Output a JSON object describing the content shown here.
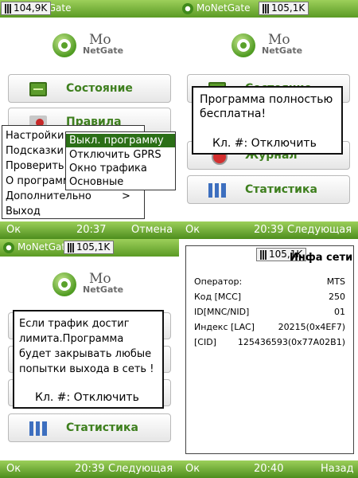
{
  "screen1": {
    "title": "MoNetGate",
    "net_speed": "104,9K",
    "logo": {
      "line1": "Mo",
      "line2": "NetGate"
    },
    "buttons": {
      "status": "Состояние",
      "rules": "Правила"
    },
    "menu": {
      "items": [
        "Настройки",
        "Подсказки",
        "Проверить",
        "О программе",
        "Дополнительно",
        "Выход"
      ],
      "submenu_arrow": ">",
      "submenu": [
        "Выкл. программу",
        "Отключить GPRS",
        "Окно трафика",
        "Основные"
      ]
    },
    "softkeys": {
      "left": "Ок",
      "time": "20:37",
      "right": "Отмена"
    }
  },
  "screen2": {
    "title": "MoNetGate",
    "net_speed": "105,1K",
    "logo": {
      "line1": "Mo",
      "line2": "NetGate"
    },
    "buttons": {
      "status": "Состояние",
      "journal": "Журнал",
      "statistics": "Статистика"
    },
    "popup": {
      "message": "Программа полностью бесплатна!",
      "hint": "Кл. #: Отключить"
    },
    "softkeys": {
      "left": "Ок",
      "time": "20:39",
      "right": "Следующая"
    }
  },
  "screen3": {
    "title": "MoNetGate",
    "net_speed": "105,1K",
    "logo": {
      "line1": "Mo",
      "line2": "NetGate"
    },
    "buttons": {
      "statistics": "Статистика"
    },
    "popup": {
      "message": "Если трафик достиг лимита.Программа будет закрывать любые попытки выхода в сеть !",
      "hint": "Кл. #: Отключить"
    },
    "softkeys": {
      "left": "Ок",
      "time": "20:39",
      "right": "Следующая"
    }
  },
  "screen4": {
    "net_speed": "105,1K",
    "heading": "Инфа сети",
    "rows": [
      {
        "label": "Оператор:",
        "value": "MTS"
      },
      {
        "label": "Код [MCC]",
        "value": "250"
      },
      {
        "label": "ID[MNC/NID]",
        "value": "01"
      },
      {
        "label": "Индекс [LAC]",
        "value": "20215(0x4EF7)"
      },
      {
        "label": "[CID]",
        "value": "125436593(0x77A02B1)"
      }
    ],
    "softkeys": {
      "left": "Ок",
      "time": "20:40",
      "right": "Назад"
    }
  },
  "colors": {
    "accent_green": "#5a9a24",
    "selection": "#2b6f17",
    "button_text": "#3e7f1e"
  }
}
